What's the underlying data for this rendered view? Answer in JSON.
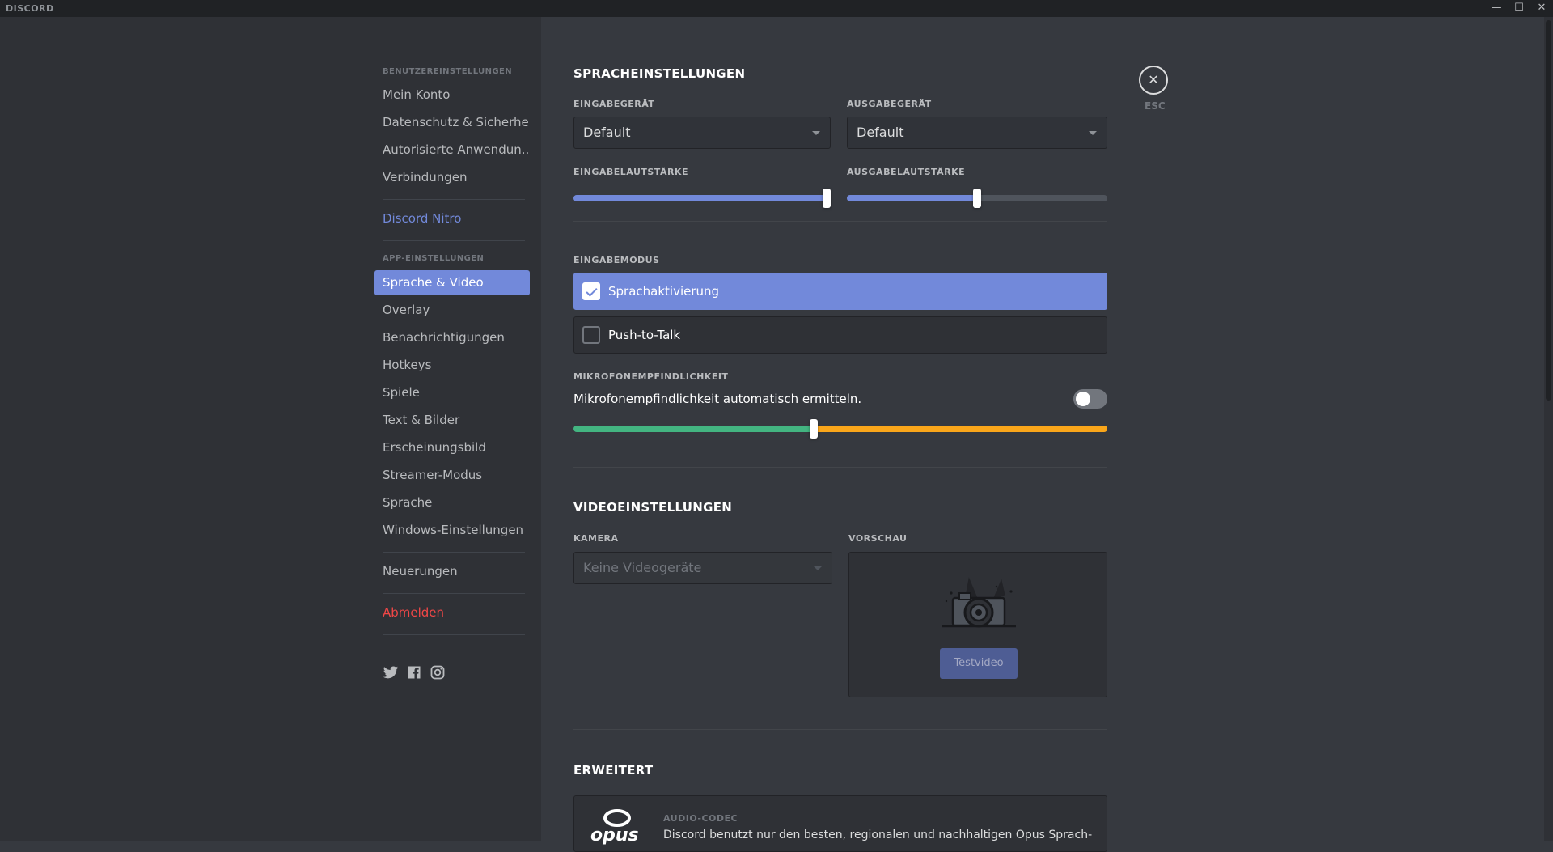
{
  "titlebar": {
    "logo": "DISCORD",
    "minimize": "—",
    "maximize": "☐",
    "close": "✕"
  },
  "sidebar": {
    "header_user": "BENUTZEREINSTELLUNGEN",
    "user_items": [
      "Mein Konto",
      "Datenschutz & Sicherheit",
      "Autorisierte Anwendun...",
      "Verbindungen"
    ],
    "nitro": "Discord Nitro",
    "header_app": "APP-EINSTELLUNGEN",
    "app_items": [
      "Sprache & Video",
      "Overlay",
      "Benachrichtigungen",
      "Hotkeys",
      "Spiele",
      "Text & Bilder",
      "Erscheinungsbild",
      "Streamer-Modus",
      "Sprache",
      "Windows-Einstellungen"
    ],
    "active_item": "Sprache & Video",
    "changelog": "Neuerungen",
    "logout": "Abmelden",
    "social_icons": [
      "twitter-icon",
      "facebook-icon",
      "instagram-icon"
    ]
  },
  "voice": {
    "title": "SPRACHEINSTELLUNGEN",
    "input_device_label": "EINGABEGERÄT",
    "input_device_value": "Default",
    "output_device_label": "AUSGABEGERÄT",
    "output_device_value": "Default",
    "input_volume_label": "EINGABELAUTSTÄRKE",
    "input_volume_level": 1.0,
    "output_volume_label": "AUSGABELAUTSTÄRKE",
    "output_volume_level": 0.5,
    "input_mode_label": "EINGABEMODUS",
    "modes": [
      {
        "label": "Sprachaktivierung",
        "selected": true
      },
      {
        "label": "Push-to-Talk",
        "selected": false
      }
    ],
    "sensitivity_label": "MIKROFONEMPFINDLICHKEIT",
    "auto_sensitivity_text": "Mikrofonempfindlichkeit automatisch ermitteln.",
    "auto_sensitivity_enabled": false,
    "sensitivity_level": 0.45
  },
  "video": {
    "title": "VIDEOEINSTELLUNGEN",
    "camera_label": "KAMERA",
    "camera_value": "Keine Videogeräte",
    "preview_label": "VORSCHAU",
    "test_button": "Testvideo"
  },
  "advanced": {
    "title": "ERWEITERT",
    "codec_label": "AUDIO-CODEC",
    "codec_logo": "opus",
    "codec_text": "Discord benutzt nur den besten, regionalen und nachhaltigen Opus Sprach-"
  },
  "close": {
    "label": "ESC"
  },
  "colors": {
    "accent": "#7289da",
    "danger": "#f04747",
    "sens_green": "#43b581",
    "sens_yellow": "#faa61a"
  }
}
